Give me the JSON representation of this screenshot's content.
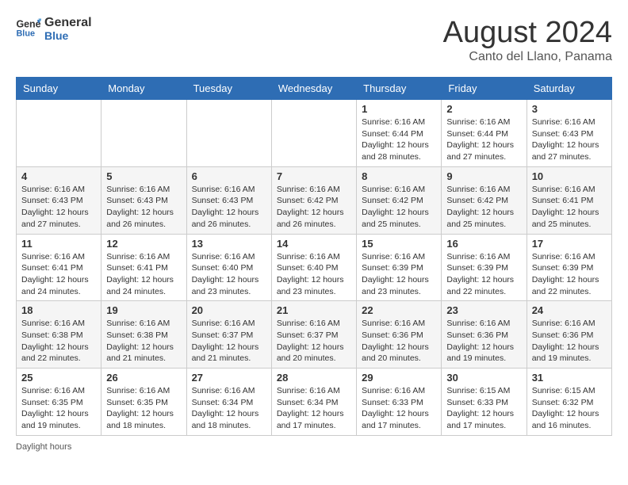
{
  "header": {
    "logo_line1": "General",
    "logo_line2": "Blue",
    "month_title": "August 2024",
    "subtitle": "Canto del Llano, Panama"
  },
  "days_of_week": [
    "Sunday",
    "Monday",
    "Tuesday",
    "Wednesday",
    "Thursday",
    "Friday",
    "Saturday"
  ],
  "weeks": [
    [
      {
        "day": "",
        "info": ""
      },
      {
        "day": "",
        "info": ""
      },
      {
        "day": "",
        "info": ""
      },
      {
        "day": "",
        "info": ""
      },
      {
        "day": "1",
        "info": "Sunrise: 6:16 AM\nSunset: 6:44 PM\nDaylight: 12 hours\nand 28 minutes."
      },
      {
        "day": "2",
        "info": "Sunrise: 6:16 AM\nSunset: 6:44 PM\nDaylight: 12 hours\nand 27 minutes."
      },
      {
        "day": "3",
        "info": "Sunrise: 6:16 AM\nSunset: 6:43 PM\nDaylight: 12 hours\nand 27 minutes."
      }
    ],
    [
      {
        "day": "4",
        "info": "Sunrise: 6:16 AM\nSunset: 6:43 PM\nDaylight: 12 hours\nand 27 minutes."
      },
      {
        "day": "5",
        "info": "Sunrise: 6:16 AM\nSunset: 6:43 PM\nDaylight: 12 hours\nand 26 minutes."
      },
      {
        "day": "6",
        "info": "Sunrise: 6:16 AM\nSunset: 6:43 PM\nDaylight: 12 hours\nand 26 minutes."
      },
      {
        "day": "7",
        "info": "Sunrise: 6:16 AM\nSunset: 6:42 PM\nDaylight: 12 hours\nand 26 minutes."
      },
      {
        "day": "8",
        "info": "Sunrise: 6:16 AM\nSunset: 6:42 PM\nDaylight: 12 hours\nand 25 minutes."
      },
      {
        "day": "9",
        "info": "Sunrise: 6:16 AM\nSunset: 6:42 PM\nDaylight: 12 hours\nand 25 minutes."
      },
      {
        "day": "10",
        "info": "Sunrise: 6:16 AM\nSunset: 6:41 PM\nDaylight: 12 hours\nand 25 minutes."
      }
    ],
    [
      {
        "day": "11",
        "info": "Sunrise: 6:16 AM\nSunset: 6:41 PM\nDaylight: 12 hours\nand 24 minutes."
      },
      {
        "day": "12",
        "info": "Sunrise: 6:16 AM\nSunset: 6:41 PM\nDaylight: 12 hours\nand 24 minutes."
      },
      {
        "day": "13",
        "info": "Sunrise: 6:16 AM\nSunset: 6:40 PM\nDaylight: 12 hours\nand 23 minutes."
      },
      {
        "day": "14",
        "info": "Sunrise: 6:16 AM\nSunset: 6:40 PM\nDaylight: 12 hours\nand 23 minutes."
      },
      {
        "day": "15",
        "info": "Sunrise: 6:16 AM\nSunset: 6:39 PM\nDaylight: 12 hours\nand 23 minutes."
      },
      {
        "day": "16",
        "info": "Sunrise: 6:16 AM\nSunset: 6:39 PM\nDaylight: 12 hours\nand 22 minutes."
      },
      {
        "day": "17",
        "info": "Sunrise: 6:16 AM\nSunset: 6:39 PM\nDaylight: 12 hours\nand 22 minutes."
      }
    ],
    [
      {
        "day": "18",
        "info": "Sunrise: 6:16 AM\nSunset: 6:38 PM\nDaylight: 12 hours\nand 22 minutes."
      },
      {
        "day": "19",
        "info": "Sunrise: 6:16 AM\nSunset: 6:38 PM\nDaylight: 12 hours\nand 21 minutes."
      },
      {
        "day": "20",
        "info": "Sunrise: 6:16 AM\nSunset: 6:37 PM\nDaylight: 12 hours\nand 21 minutes."
      },
      {
        "day": "21",
        "info": "Sunrise: 6:16 AM\nSunset: 6:37 PM\nDaylight: 12 hours\nand 20 minutes."
      },
      {
        "day": "22",
        "info": "Sunrise: 6:16 AM\nSunset: 6:36 PM\nDaylight: 12 hours\nand 20 minutes."
      },
      {
        "day": "23",
        "info": "Sunrise: 6:16 AM\nSunset: 6:36 PM\nDaylight: 12 hours\nand 19 minutes."
      },
      {
        "day": "24",
        "info": "Sunrise: 6:16 AM\nSunset: 6:36 PM\nDaylight: 12 hours\nand 19 minutes."
      }
    ],
    [
      {
        "day": "25",
        "info": "Sunrise: 6:16 AM\nSunset: 6:35 PM\nDaylight: 12 hours\nand 19 minutes."
      },
      {
        "day": "26",
        "info": "Sunrise: 6:16 AM\nSunset: 6:35 PM\nDaylight: 12 hours\nand 18 minutes."
      },
      {
        "day": "27",
        "info": "Sunrise: 6:16 AM\nSunset: 6:34 PM\nDaylight: 12 hours\nand 18 minutes."
      },
      {
        "day": "28",
        "info": "Sunrise: 6:16 AM\nSunset: 6:34 PM\nDaylight: 12 hours\nand 17 minutes."
      },
      {
        "day": "29",
        "info": "Sunrise: 6:16 AM\nSunset: 6:33 PM\nDaylight: 12 hours\nand 17 minutes."
      },
      {
        "day": "30",
        "info": "Sunrise: 6:15 AM\nSunset: 6:33 PM\nDaylight: 12 hours\nand 17 minutes."
      },
      {
        "day": "31",
        "info": "Sunrise: 6:15 AM\nSunset: 6:32 PM\nDaylight: 12 hours\nand 16 minutes."
      }
    ]
  ],
  "footer": {
    "text": "Daylight hours"
  }
}
